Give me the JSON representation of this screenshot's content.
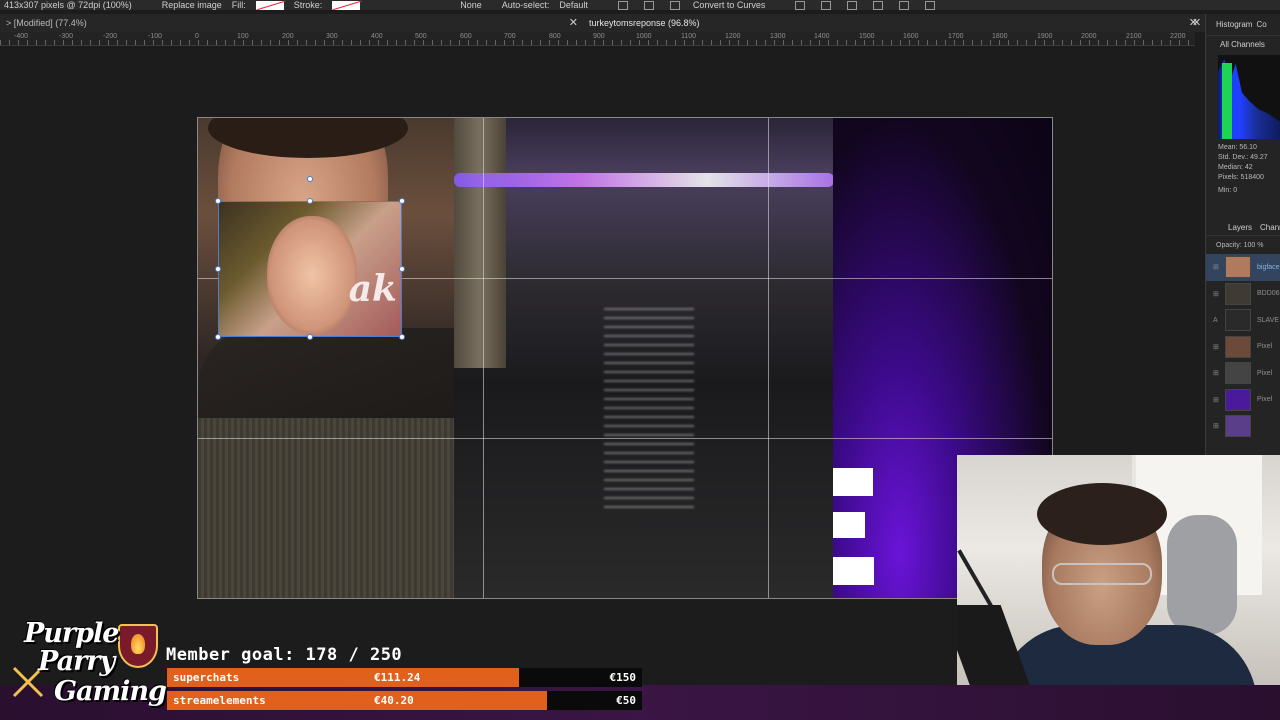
{
  "toolbar": {
    "doc_info": "413x307 pixels @ 72dpi (100%)",
    "replace_image": "Replace image",
    "fill_label": "Fill:",
    "stroke_label": "Stroke:",
    "none_label": "None",
    "auto_select_label": "Auto-select:",
    "auto_select_value": "Default",
    "convert_curves": "Convert to Curves"
  },
  "tabs": [
    {
      "label": "> [Modified] (77.4%)"
    },
    {
      "label": "turkeytomsreponse (96.8%)"
    }
  ],
  "ruler_labels": [
    "-400",
    "-300",
    "-200",
    "-100",
    "0",
    "100",
    "200",
    "300",
    "400",
    "500",
    "600",
    "700",
    "800",
    "900",
    "1000",
    "1100",
    "1200",
    "1300",
    "1400",
    "1500",
    "1600",
    "1700",
    "1800",
    "1900",
    "2000",
    "2100",
    "2200"
  ],
  "canvas": {
    "inset_text": "ak"
  },
  "right_panel": {
    "tab_histogram": "Histogram",
    "tab_other": "Co",
    "channels": "All Channels",
    "stats": {
      "mean": "Mean: 56.10",
      "std_dev": "Std. Dev.: 49.27",
      "median": "Median: 42",
      "pixels": "Pixels: 518400",
      "min_label": "Min:",
      "min_value": "0"
    },
    "layers_tab": "Layers",
    "channels_tab": "Channe",
    "opacity_label": "Opacity:",
    "opacity_value": "100 %",
    "layers": [
      {
        "name": "bigface",
        "selected": true,
        "color": "#b07a5f"
      },
      {
        "name": "BDD06",
        "selected": false,
        "color": "#3f3a33"
      },
      {
        "name": "SLAVE",
        "selected": false,
        "color": "#2a2a2a"
      },
      {
        "name": "Pixel",
        "selected": false,
        "color": "#6b4a3a"
      },
      {
        "name": "Pixel",
        "selected": false,
        "color": "#444444"
      },
      {
        "name": "Pixel",
        "selected": false,
        "color": "#4b1a9a"
      },
      {
        "name": "",
        "selected": false,
        "color": "#5a3e8a"
      }
    ]
  },
  "overlay": {
    "logo_line1": "Purple",
    "logo_line2": "Parry",
    "logo_line3": "Gaming",
    "member_goal": "Member goal: 178 / 250",
    "bars": [
      {
        "label": "superchats",
        "value": "€111.24",
        "target": "€150",
        "progress": 0.74
      },
      {
        "label": "streamelements",
        "value": "€40.20",
        "target": "€50",
        "progress": 0.8
      }
    ]
  },
  "colors": {
    "accent_orange": "#e0601c",
    "purple": "#6a14d8",
    "selection_blue": "#4a7fd0"
  }
}
